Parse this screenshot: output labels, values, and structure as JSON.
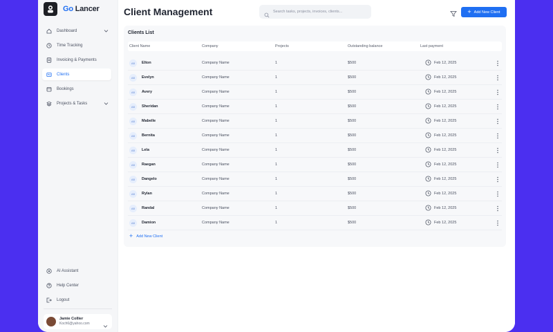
{
  "brand": {
    "go": "Go",
    "lancer": "Lancer"
  },
  "sidebar": {
    "items": [
      {
        "label": "Dashboard",
        "icon": "home-icon",
        "has_chevron": true
      },
      {
        "label": "Time Tracking",
        "icon": "clock-icon"
      },
      {
        "label": "Invoicing & Payments",
        "icon": "invoice-icon"
      },
      {
        "label": "Clients",
        "icon": "clients-icon",
        "active": true
      },
      {
        "label": "Bookings",
        "icon": "bookings-icon"
      },
      {
        "label": "Projects & Tasks",
        "icon": "layers-icon",
        "has_chevron": true
      }
    ],
    "bottom_items": [
      {
        "label": "AI Assistant",
        "icon": "ai-icon"
      },
      {
        "label": "Help Center",
        "icon": "help-icon"
      },
      {
        "label": "Logout",
        "icon": "logout-icon"
      }
    ],
    "user": {
      "name": "Jamie Collier",
      "email": "Koch6@yahoo.com"
    }
  },
  "header": {
    "title": "Client Management",
    "search_placeholder": "Search tasks, projects, invoices, clients...",
    "add_button": "Add New Client"
  },
  "panel": {
    "title": "Clients List",
    "columns": [
      "Client Name",
      "Company",
      "Projects",
      "Outstanding balance",
      "Last payment"
    ],
    "rows": [
      {
        "initials": "AB",
        "name": "Elton",
        "company": "Company Name",
        "projects": "1",
        "balance": "$500",
        "last_payment": "Feb 12, 2025"
      },
      {
        "initials": "AB",
        "name": "Evelyn",
        "company": "Company Name",
        "projects": "1",
        "balance": "$500",
        "last_payment": "Feb 12, 2025"
      },
      {
        "initials": "AB",
        "name": "Avery",
        "company": "Company Name",
        "projects": "1",
        "balance": "$500",
        "last_payment": "Feb 12, 2025"
      },
      {
        "initials": "AB",
        "name": "Sheridan",
        "company": "Company Name",
        "projects": "1",
        "balance": "$500",
        "last_payment": "Feb 12, 2025"
      },
      {
        "initials": "AB",
        "name": "Mabelle",
        "company": "Company Name",
        "projects": "1",
        "balance": "$500",
        "last_payment": "Feb 12, 2025"
      },
      {
        "initials": "AB",
        "name": "Bernita",
        "company": "Company Name",
        "projects": "1",
        "balance": "$500",
        "last_payment": "Feb 12, 2025"
      },
      {
        "initials": "AB",
        "name": "Lela",
        "company": "Company Name",
        "projects": "1",
        "balance": "$500",
        "last_payment": "Feb 12, 2025"
      },
      {
        "initials": "AB",
        "name": "Raegan",
        "company": "Company Name",
        "projects": "1",
        "balance": "$500",
        "last_payment": "Feb 12, 2025"
      },
      {
        "initials": "AB",
        "name": "Dangelo",
        "company": "Company Name",
        "projects": "1",
        "balance": "$500",
        "last_payment": "Feb 12, 2025"
      },
      {
        "initials": "AB",
        "name": "Rylan",
        "company": "Company Name",
        "projects": "1",
        "balance": "$500",
        "last_payment": "Feb 12, 2025"
      },
      {
        "initials": "AB",
        "name": "Randal",
        "company": "Company Name",
        "projects": "1",
        "balance": "$500",
        "last_payment": "Feb 12, 2025"
      },
      {
        "initials": "AB",
        "name": "Damion",
        "company": "Company Name",
        "projects": "1",
        "balance": "$500",
        "last_payment": "Feb 12, 2025"
      }
    ],
    "add_client": "Add New Client"
  },
  "colors": {
    "accent": "#1f6ff2",
    "background": "#4b2ff0"
  }
}
